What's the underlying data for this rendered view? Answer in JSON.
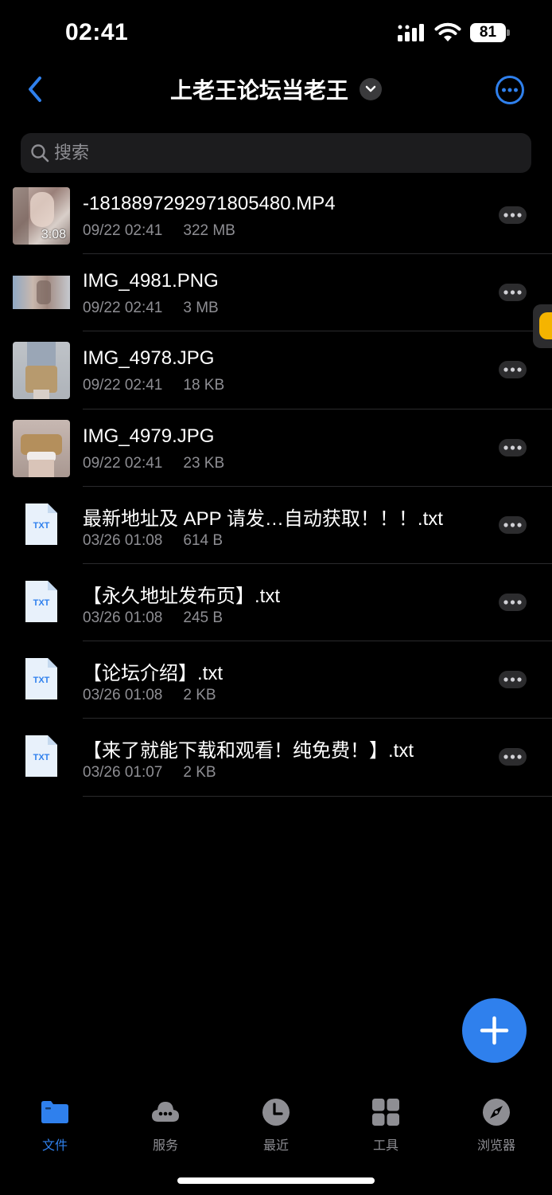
{
  "status_bar": {
    "time": "02:41",
    "battery": "81"
  },
  "nav": {
    "title": "上老王论坛当老王"
  },
  "search": {
    "placeholder": "搜索"
  },
  "files": [
    {
      "name": "-1818897292971805480.MP4",
      "date": "09/22 02:41",
      "size": "322 MB",
      "kind": "video",
      "duration": "3:08"
    },
    {
      "name": "IMG_4981.PNG",
      "date": "09/22 02:41",
      "size": "3 MB",
      "kind": "image"
    },
    {
      "name": "IMG_4978.JPG",
      "date": "09/22 02:41",
      "size": "18 KB",
      "kind": "image"
    },
    {
      "name": "IMG_4979.JPG",
      "date": "09/22 02:41",
      "size": "23 KB",
      "kind": "image"
    },
    {
      "name": "最新地址及 APP 请发…自动获取！！！.txt",
      "date": "03/26 01:08",
      "size": "614 B",
      "kind": "txt",
      "icon_label": "TXT"
    },
    {
      "name": "【永久地址发布页】.txt",
      "date": "03/26 01:08",
      "size": "245 B",
      "kind": "txt",
      "icon_label": "TXT"
    },
    {
      "name": "【论坛介绍】.txt",
      "date": "03/26 01:08",
      "size": "2 KB",
      "kind": "txt",
      "icon_label": "TXT"
    },
    {
      "name": "【来了就能下载和观看！纯免费！】.txt",
      "date": "03/26 01:07",
      "size": "2 KB",
      "kind": "txt",
      "icon_label": "TXT"
    }
  ],
  "tabs": [
    {
      "label": "文件",
      "icon": "folder-icon",
      "active": true
    },
    {
      "label": "服务",
      "icon": "cloud-icon",
      "active": false
    },
    {
      "label": "最近",
      "icon": "clock-icon",
      "active": false
    },
    {
      "label": "工具",
      "icon": "grid-icon",
      "active": false
    },
    {
      "label": "浏览器",
      "icon": "compass-icon",
      "active": false
    }
  ],
  "colors": {
    "accent": "#2f80ed",
    "background": "#000000",
    "secondary_text": "#8e8e93"
  }
}
